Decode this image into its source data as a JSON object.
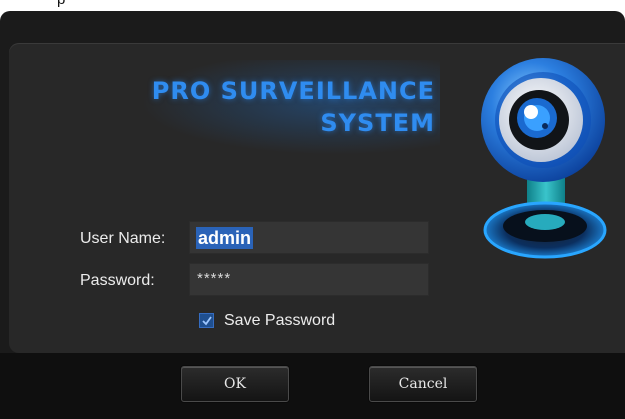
{
  "top_fragment": "p",
  "brand": {
    "line1": "PRO SURVEILLANCE",
    "line2": "SYSTEM"
  },
  "form": {
    "username_label": "User Name:",
    "username_value": "admin",
    "password_label": "Password:",
    "password_value": "*****",
    "save_password_label": "Save Password",
    "save_password_checked": true
  },
  "buttons": {
    "ok": "OK",
    "cancel": "Cancel"
  },
  "colors": {
    "brand_text": "#2f8cf0",
    "dialog_bg": "#1b1b1b",
    "selection": "#2a63b8"
  },
  "icons": {
    "logo": "camera-eye-icon"
  }
}
